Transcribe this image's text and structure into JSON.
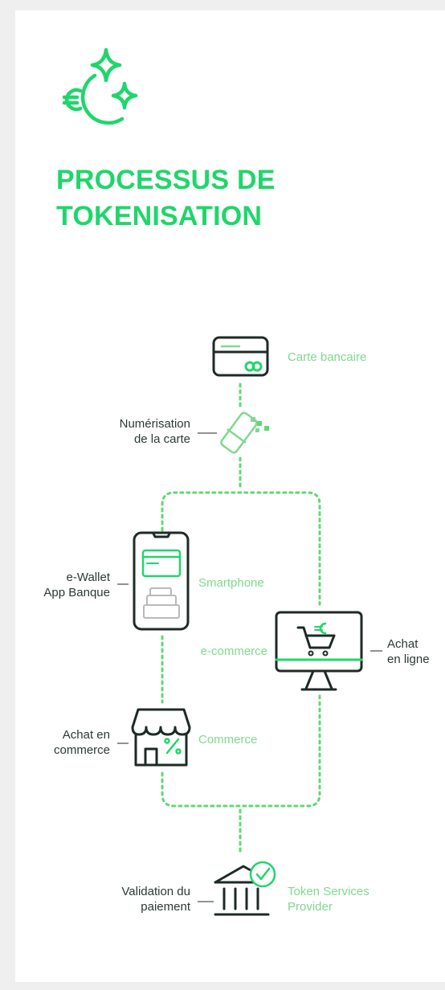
{
  "colors": {
    "accent": "#1fd66b",
    "light_green": "#7fd98f",
    "dark": "#1e2a25",
    "dots": "#5fd971"
  },
  "title": {
    "line1": "PROCESSUS DE",
    "line2": "TOKENISATION"
  },
  "header_icon": "euro-sparkle-icon",
  "nodes": {
    "carte": {
      "label": "Carte bancaire",
      "icon": "credit-card-icon"
    },
    "numerisation": {
      "line1": "Numérisation",
      "line2": "de la carte",
      "icon": "card-digitization-icon"
    },
    "smartphone": {
      "label": "Smartphone",
      "left_line1": "e-Wallet",
      "left_line2": "App Banque",
      "icon": "smartphone-icon"
    },
    "ecommerce": {
      "label": "e-commerce",
      "right_line1": "Achat",
      "right_line2": "en ligne",
      "icon": "computer-cart-icon"
    },
    "commerce": {
      "label": "Commerce",
      "left_line1": "Achat en",
      "left_line2": "commerce",
      "icon": "shop-icon"
    },
    "validation": {
      "left_line1": "Validation du",
      "left_line2": "paiement",
      "right_line1": "Token Services",
      "right_line2": "Provider",
      "icon": "bank-check-icon"
    }
  }
}
